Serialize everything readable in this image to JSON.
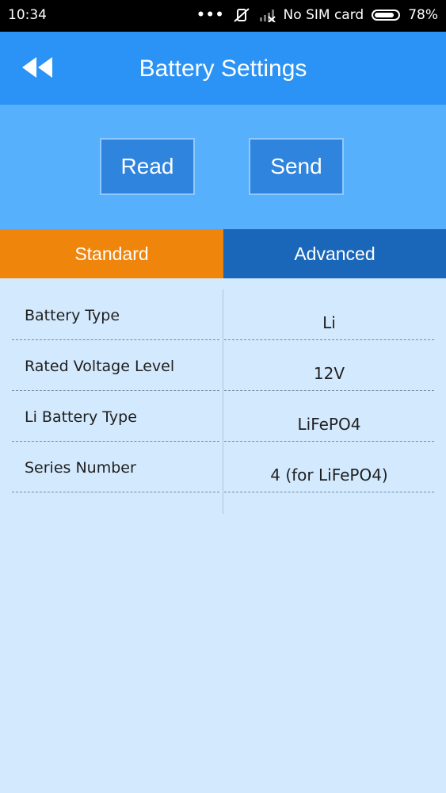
{
  "status_bar": {
    "time": "10:34",
    "dots": "•••",
    "carrier": "No SIM card",
    "battery_pct": "78%",
    "battery_level": 0.78
  },
  "app_bar": {
    "title": "Battery Settings",
    "back_icon": "double-chevron-left-icon"
  },
  "actions": {
    "read_label": "Read",
    "send_label": "Send"
  },
  "tabs": [
    {
      "label": "Standard",
      "active": true
    },
    {
      "label": "Advanced",
      "active": false
    }
  ],
  "settings": [
    {
      "label": "Battery Type",
      "value": "Li"
    },
    {
      "label": "Rated Voltage Level",
      "value": "12V"
    },
    {
      "label": "Li Battery Type",
      "value": "LiFePO4"
    },
    {
      "label": "Series Number",
      "value": "4 (for LiFePO4)"
    }
  ],
  "colors": {
    "app_bar": "#2b93f5",
    "action_panel": "#56b0fb",
    "tab_active": "#f0850c",
    "tab_inactive": "#1a67b9",
    "content_bg": "#d3e9fd"
  }
}
